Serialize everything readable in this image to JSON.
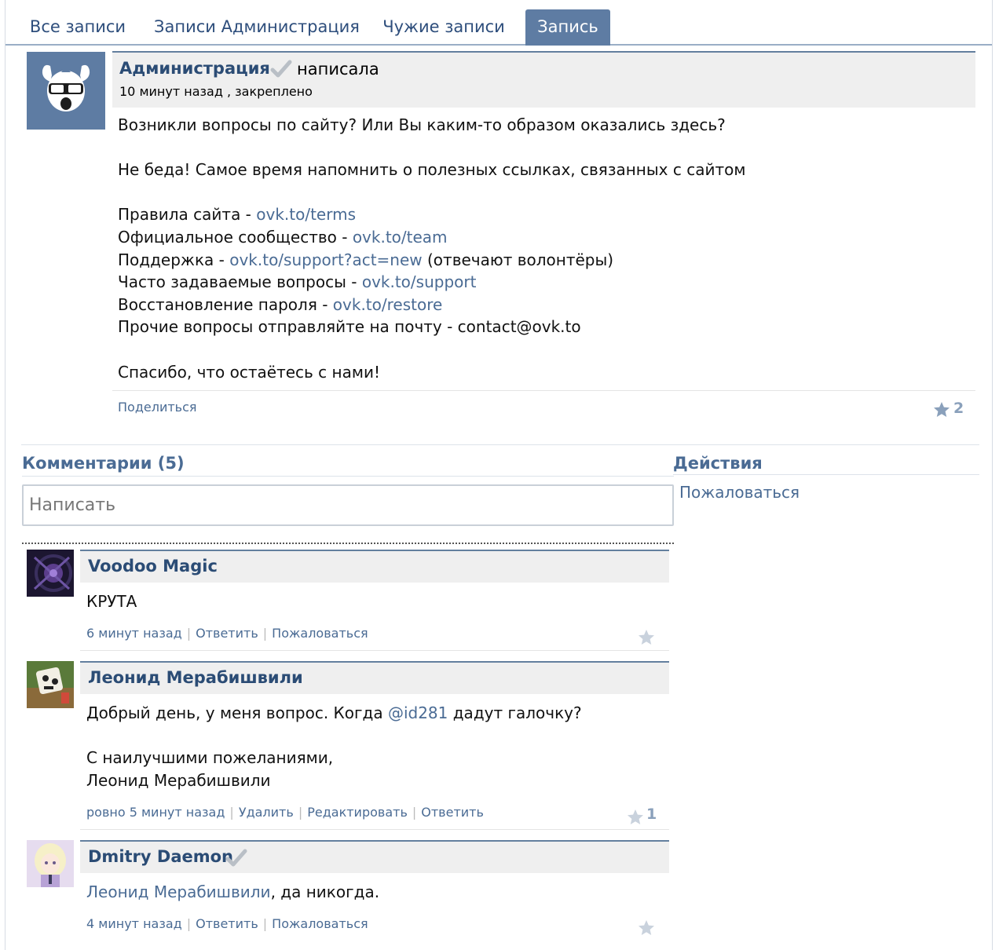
{
  "tabs": [
    {
      "label": "Все записи"
    },
    {
      "label": "Записи Администрация"
    },
    {
      "label": "Чужие записи"
    },
    {
      "label": "Запись"
    }
  ],
  "post": {
    "author": "Администрация",
    "wrote": "написала",
    "meta": "10 минут назад , закреплено",
    "intro1": "Возникли вопросы по сайту? Или Вы каким-то образом оказались здесь?",
    "intro2": "Не беда! Самое время напомнить о полезных ссылках, связанных с сайтом",
    "links": [
      {
        "prefix": "Правила сайта - ",
        "link": "ovk.to/terms",
        "suffix": ""
      },
      {
        "prefix": "Официальное сообщество - ",
        "link": "ovk.to/team",
        "suffix": ""
      },
      {
        "prefix": "Поддержка - ",
        "link": "ovk.to/support?act=new",
        "suffix": " (отвечают волонтёры)"
      },
      {
        "prefix": "Часто задаваемые вопросы - ",
        "link": "ovk.to/support",
        "suffix": ""
      },
      {
        "prefix": "Восстановление пароля - ",
        "link": "ovk.to/restore",
        "suffix": ""
      },
      {
        "prefix": "Прочие вопросы отправляйте на почту - contact@ovk.to",
        "link": "",
        "suffix": ""
      }
    ],
    "outro": "Спасибо, что остаётесь с нами!",
    "share_label": "Поделиться",
    "likes": "2"
  },
  "comments_section": {
    "title": "Комментарии (5)",
    "input_placeholder": "Написать"
  },
  "actions_section": {
    "title": "Действия",
    "report": "Пожаловаться"
  },
  "comments": [
    {
      "author": "Voodoo Magic",
      "lines": [
        "КРУТА"
      ],
      "time": "6 минут назад",
      "actions": [
        "Ответить",
        "Пожаловаться"
      ],
      "likes": ""
    },
    {
      "author": "Леонид Мерабишвили",
      "line1_before": "Добрый день, у меня вопрос. Когда ",
      "line1_mention": "@id281",
      "line1_after": " дадут галочку?",
      "line2": "С наилучшими пожеланиями,",
      "line3": "Леонид Мерабишвили",
      "time": "ровно 5 минут назад",
      "actions": [
        "Удалить",
        "Редактировать",
        "Ответить"
      ],
      "likes": "1"
    },
    {
      "author": "Dmitry Daemon",
      "mention": "Леонид Мерабишвили",
      "text_after": ", да никогда.",
      "time": "4 минут назад",
      "actions": [
        "Ответить",
        "Пожаловаться"
      ],
      "likes": ""
    }
  ],
  "colors": {
    "accent": "#5e7ca3",
    "link": "#4a6b94",
    "author": "#2b4c75",
    "header_bg": "#efefef"
  },
  "icons": [
    "check-icon",
    "star-icon",
    "openvk-logo-icon"
  ]
}
